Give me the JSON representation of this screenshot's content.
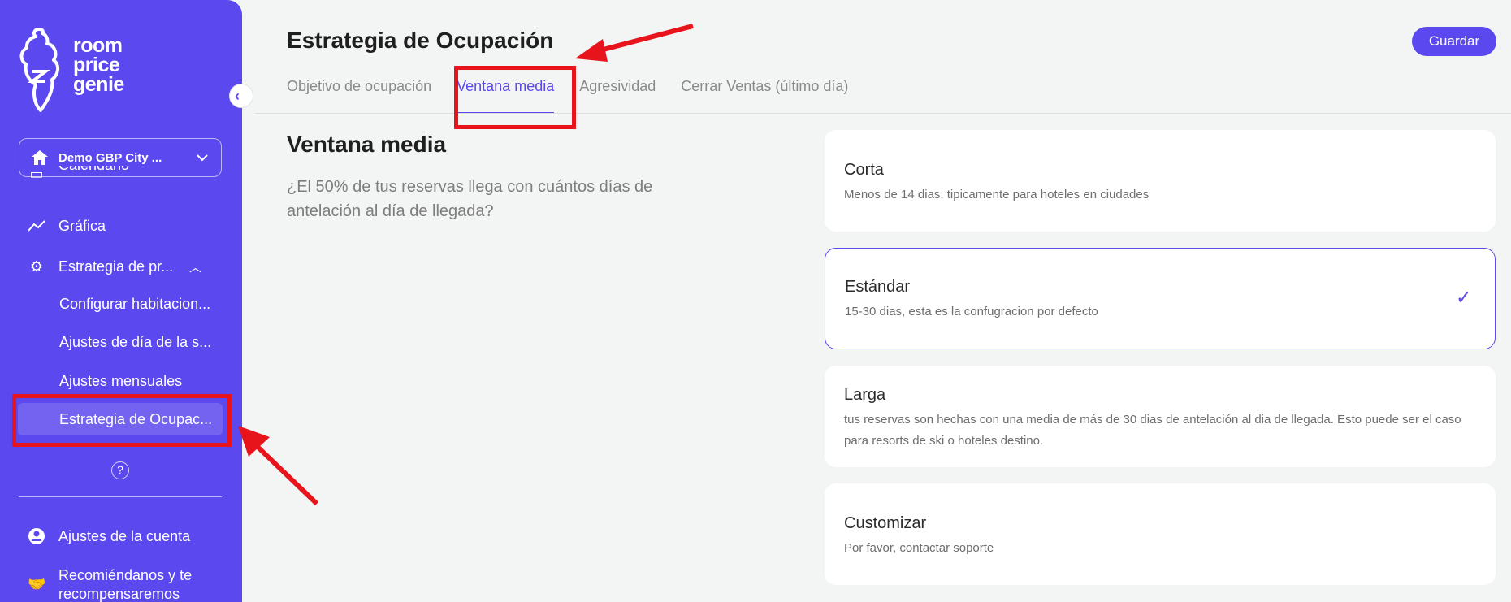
{
  "brand": {
    "logo_lines": [
      "room",
      "price",
      "genie"
    ],
    "accent": "#5b48ee"
  },
  "hotel": {
    "name": "Demo GBP City ..."
  },
  "sidebar": {
    "items": [
      {
        "label": "Calendario",
        "icon": "calendar-icon"
      },
      {
        "label": "Gráfica",
        "icon": "chart-line-icon"
      },
      {
        "label": "Estrategia de pr...",
        "icon": "gear-icon"
      }
    ],
    "subitems": [
      {
        "label": "Configurar habitacion..."
      },
      {
        "label": "Ajustes de día de la s..."
      },
      {
        "label": "Ajustes mensuales"
      },
      {
        "label": "Estrategia de Ocupac..."
      }
    ],
    "help_glyph": "?",
    "bottom": [
      {
        "label": "Ajustes de la cuenta",
        "icon": "user-circle-icon"
      },
      {
        "label": "Recomiéndanos y te recompensaremos",
        "icon": "handshake-icon"
      }
    ]
  },
  "header": {
    "title": "Estrategia de Ocupación",
    "save_label": "Guardar"
  },
  "tabs": [
    {
      "label": "Objetivo de ocupación"
    },
    {
      "label": "Ventana media"
    },
    {
      "label": "Agresividad"
    },
    {
      "label": "Cerrar Ventas (último día)"
    }
  ],
  "section": {
    "title": "Ventana media",
    "description": "¿El 50% de tus reservas llega con cuántos días de antelación al día de llegada?"
  },
  "options": [
    {
      "title": "Corta",
      "desc": "Menos de 14 dias, tipicamente para hoteles en ciudades"
    },
    {
      "title": "Estándar",
      "desc": "15-30 dias, esta es la confugracion por defecto",
      "selected": true
    },
    {
      "title": "Larga",
      "desc": "tus reservas son hechas con una media de más de 30 dias de antelación al dia de llegada. Esto puede ser el caso para resorts de ski o hoteles destino."
    },
    {
      "title": "Customizar",
      "desc": "Por favor, contactar soporte"
    }
  ]
}
